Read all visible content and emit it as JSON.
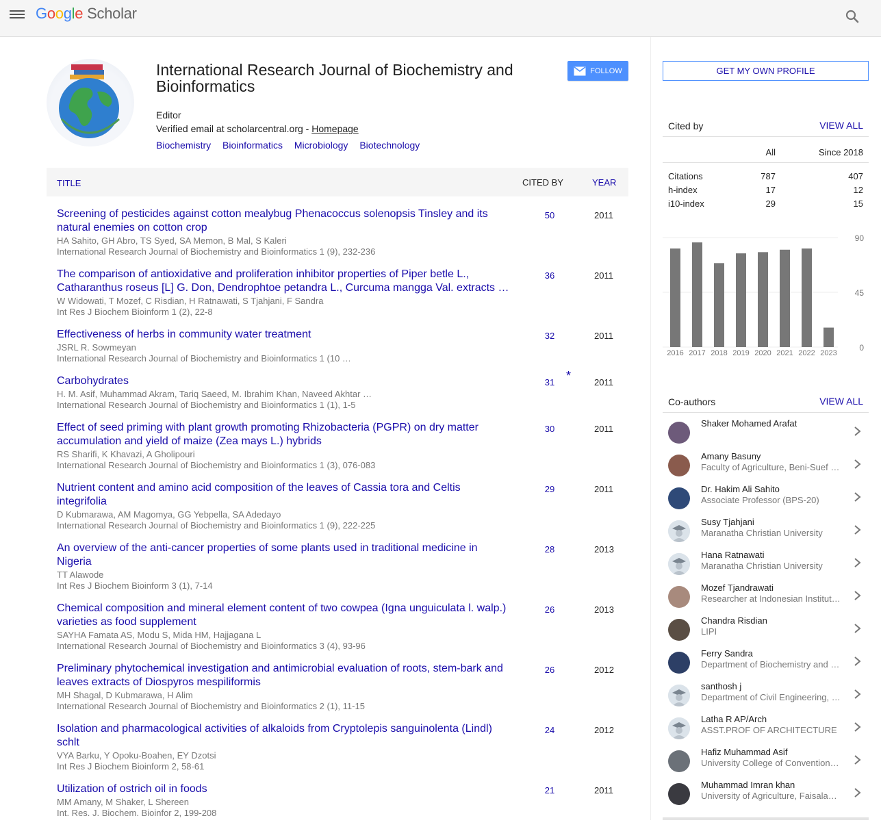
{
  "logo": {
    "g": "G",
    "o1": "o",
    "o2": "o",
    "g2": "g",
    "l": "l",
    "e": "e",
    "scholar": "Scholar"
  },
  "profile": {
    "name": "International Research Journal of Biochemistry and Bioinformatics",
    "affiliation": "Editor",
    "email_text": "Verified email at scholarcentral.org - ",
    "homepage": "Homepage",
    "interests": [
      "Biochemistry",
      "Bioinformatics",
      "Microbiology",
      "Biotechnology"
    ],
    "follow_label": "FOLLOW"
  },
  "table": {
    "title_header": "TITLE",
    "cited_header": "CITED BY",
    "year_header": "YEAR",
    "articles": [
      {
        "title": "Screening of pesticides against cotton mealybug Phenacoccus solenopsis Tinsley and its natural enemies on cotton crop",
        "authors": "HA Sahito, GH Abro, TS Syed, SA Memon, B Mal, S Kaleri",
        "venue": "International Research Journal of Biochemistry and Bioinformatics 1 (9), 232-236",
        "cited": "50",
        "year": "2011"
      },
      {
        "title": "The comparison of antioxidative and proliferation inhibitor properties of Piper betle L., Catharanthus roseus [L] G. Don, Dendrophtoe petandra L., Curcuma mangga Val. extracts …",
        "authors": "W Widowati, T Mozef, C Risdian, H Ratnawati, S Tjahjani, F Sandra",
        "venue": "Int Res J Biochem Bioinform 1 (2), 22-8",
        "cited": "36",
        "year": "2011"
      },
      {
        "title": "Effectiveness of herbs in community water treatment",
        "authors": "JSRL R. Sowmeyan",
        "venue": "International Research Journal of Biochemistry and Bioinformatics 1 (10 …",
        "cited": "32",
        "year": "2011"
      },
      {
        "title": "Carbohydrates",
        "authors": "H. M. Asif, Muhammad Akram, Tariq Saeed, M. Ibrahim Khan, Naveed Akhtar …",
        "venue": "International Research Journal of Biochemistry and Bioinformatics 1 (1), 1-5",
        "cited": "31",
        "star": "*",
        "year": "2011"
      },
      {
        "title": "Effect of seed priming with plant growth promoting Rhizobacteria (PGPR) on dry matter accumulation and yield of maize (Zea mays L.) hybrids",
        "authors": "RS Sharifi, K Khavazi, A Gholipouri",
        "venue": "International Research Journal of Biochemistry and Bioinformatics 1 (3), 076-083",
        "cited": "30",
        "year": "2011"
      },
      {
        "title": "Nutrient content and amino acid composition of the leaves of Cassia tora and Celtis integrifolia",
        "authors": "D Kubmarawa, AM Magomya, GG Yebpella, SA Adedayo",
        "venue": "International Research Journal of Biochemistry and Bioinformatics 1 (9), 222-225",
        "cited": "29",
        "year": "2011"
      },
      {
        "title": "An overview of the anti-cancer properties of some plants used in traditional medicine in Nigeria",
        "authors": "TT Alawode",
        "venue": "Int Res J Biochem Bioinform 3 (1), 7-14",
        "cited": "28",
        "year": "2013"
      },
      {
        "title": "Chemical composition and mineral element content of two cowpea (Igna unguiculata l. walp.) varieties as food supplement",
        "authors": "SAYHA Famata AS, Modu S, Mida HM, Hajjagana L",
        "venue": "International Research Journal of Biochemistry and Bioinformatics 3 (4), 93-96",
        "cited": "26",
        "year": "2013"
      },
      {
        "title": "Preliminary phytochemical investigation and antimicrobial evaluation of roots, stem-bark and leaves extracts of Diospyros mespiliformis",
        "authors": "MH Shagal, D Kubmarawa, H Alim",
        "venue": "International Research Journal of Biochemistry and Bioinformatics 2 (1), 11-15",
        "cited": "26",
        "year": "2012"
      },
      {
        "title": "Isolation and pharmacological activities of alkaloids from Cryptolepis sanguinolenta (Lindl) schlt",
        "authors": "VYA Barku, Y Opoku-Boahen, EY Dzotsi",
        "venue": "Int Res J Biochem Bioinform 2, 58-61",
        "cited": "24",
        "year": "2012"
      },
      {
        "title": "Utilization of ostrich oil in foods",
        "authors": "MM Amany, M Shaker, L Shereen",
        "venue": "Int. Res. J. Biochem. Bioinfor 2, 199-208",
        "cited": "21",
        "year": "2011"
      }
    ]
  },
  "sidebar": {
    "own_profile": "GET MY OWN PROFILE",
    "cited_by": "Cited by",
    "view_all": "VIEW ALL",
    "col_all": "All",
    "col_since": "Since 2018",
    "stats": [
      {
        "label": "Citations",
        "all": "787",
        "since": "407"
      },
      {
        "label": "h-index",
        "all": "17",
        "since": "12"
      },
      {
        "label": "i10-index",
        "all": "29",
        "since": "15"
      }
    ],
    "coauthors_label": "Co-authors",
    "coauthors": [
      {
        "name": "Shaker Mohamed Arafat",
        "affil": ""
      },
      {
        "name": "Amany Basuny",
        "affil": "Faculty of Agriculture, Beni-Suef University"
      },
      {
        "name": "Dr. Hakim Ali Sahito",
        "affil": "Associate Professor (BPS-20)"
      },
      {
        "name": "Susy Tjahjani",
        "affil": "Maranatha Christian University"
      },
      {
        "name": "Hana Ratnawati",
        "affil": "Maranatha Christian University"
      },
      {
        "name": "Mozef Tjandrawati",
        "affil": "Researcher at Indonesian Institute of Sciences"
      },
      {
        "name": "Chandra Risdian",
        "affil": "LIPI"
      },
      {
        "name": "Ferry Sandra",
        "affil": "Department of Biochemistry and Molecular Biology"
      },
      {
        "name": "santhosh j",
        "affil": "Department of Civil Engineering, Faculty"
      },
      {
        "name": "Latha R AP/Arch",
        "affil": "ASST.PROF OF ARCHITECTURE"
      },
      {
        "name": "Hafiz Muhammad Asif",
        "affil": "University College of Conventional Medicine"
      },
      {
        "name": "Muhammad Imran khan",
        "affil": "University of Agriculture, Faisalabad"
      }
    ]
  },
  "chart_data": {
    "type": "bar",
    "categories": [
      "2016",
      "2017",
      "2018",
      "2019",
      "2020",
      "2021",
      "2022",
      "2023"
    ],
    "values": [
      81,
      86,
      69,
      77,
      78,
      80,
      81,
      16
    ],
    "yticks": [
      "0",
      "45",
      "90"
    ],
    "ylim": [
      0,
      90
    ],
    "bar_color": "#777777"
  }
}
